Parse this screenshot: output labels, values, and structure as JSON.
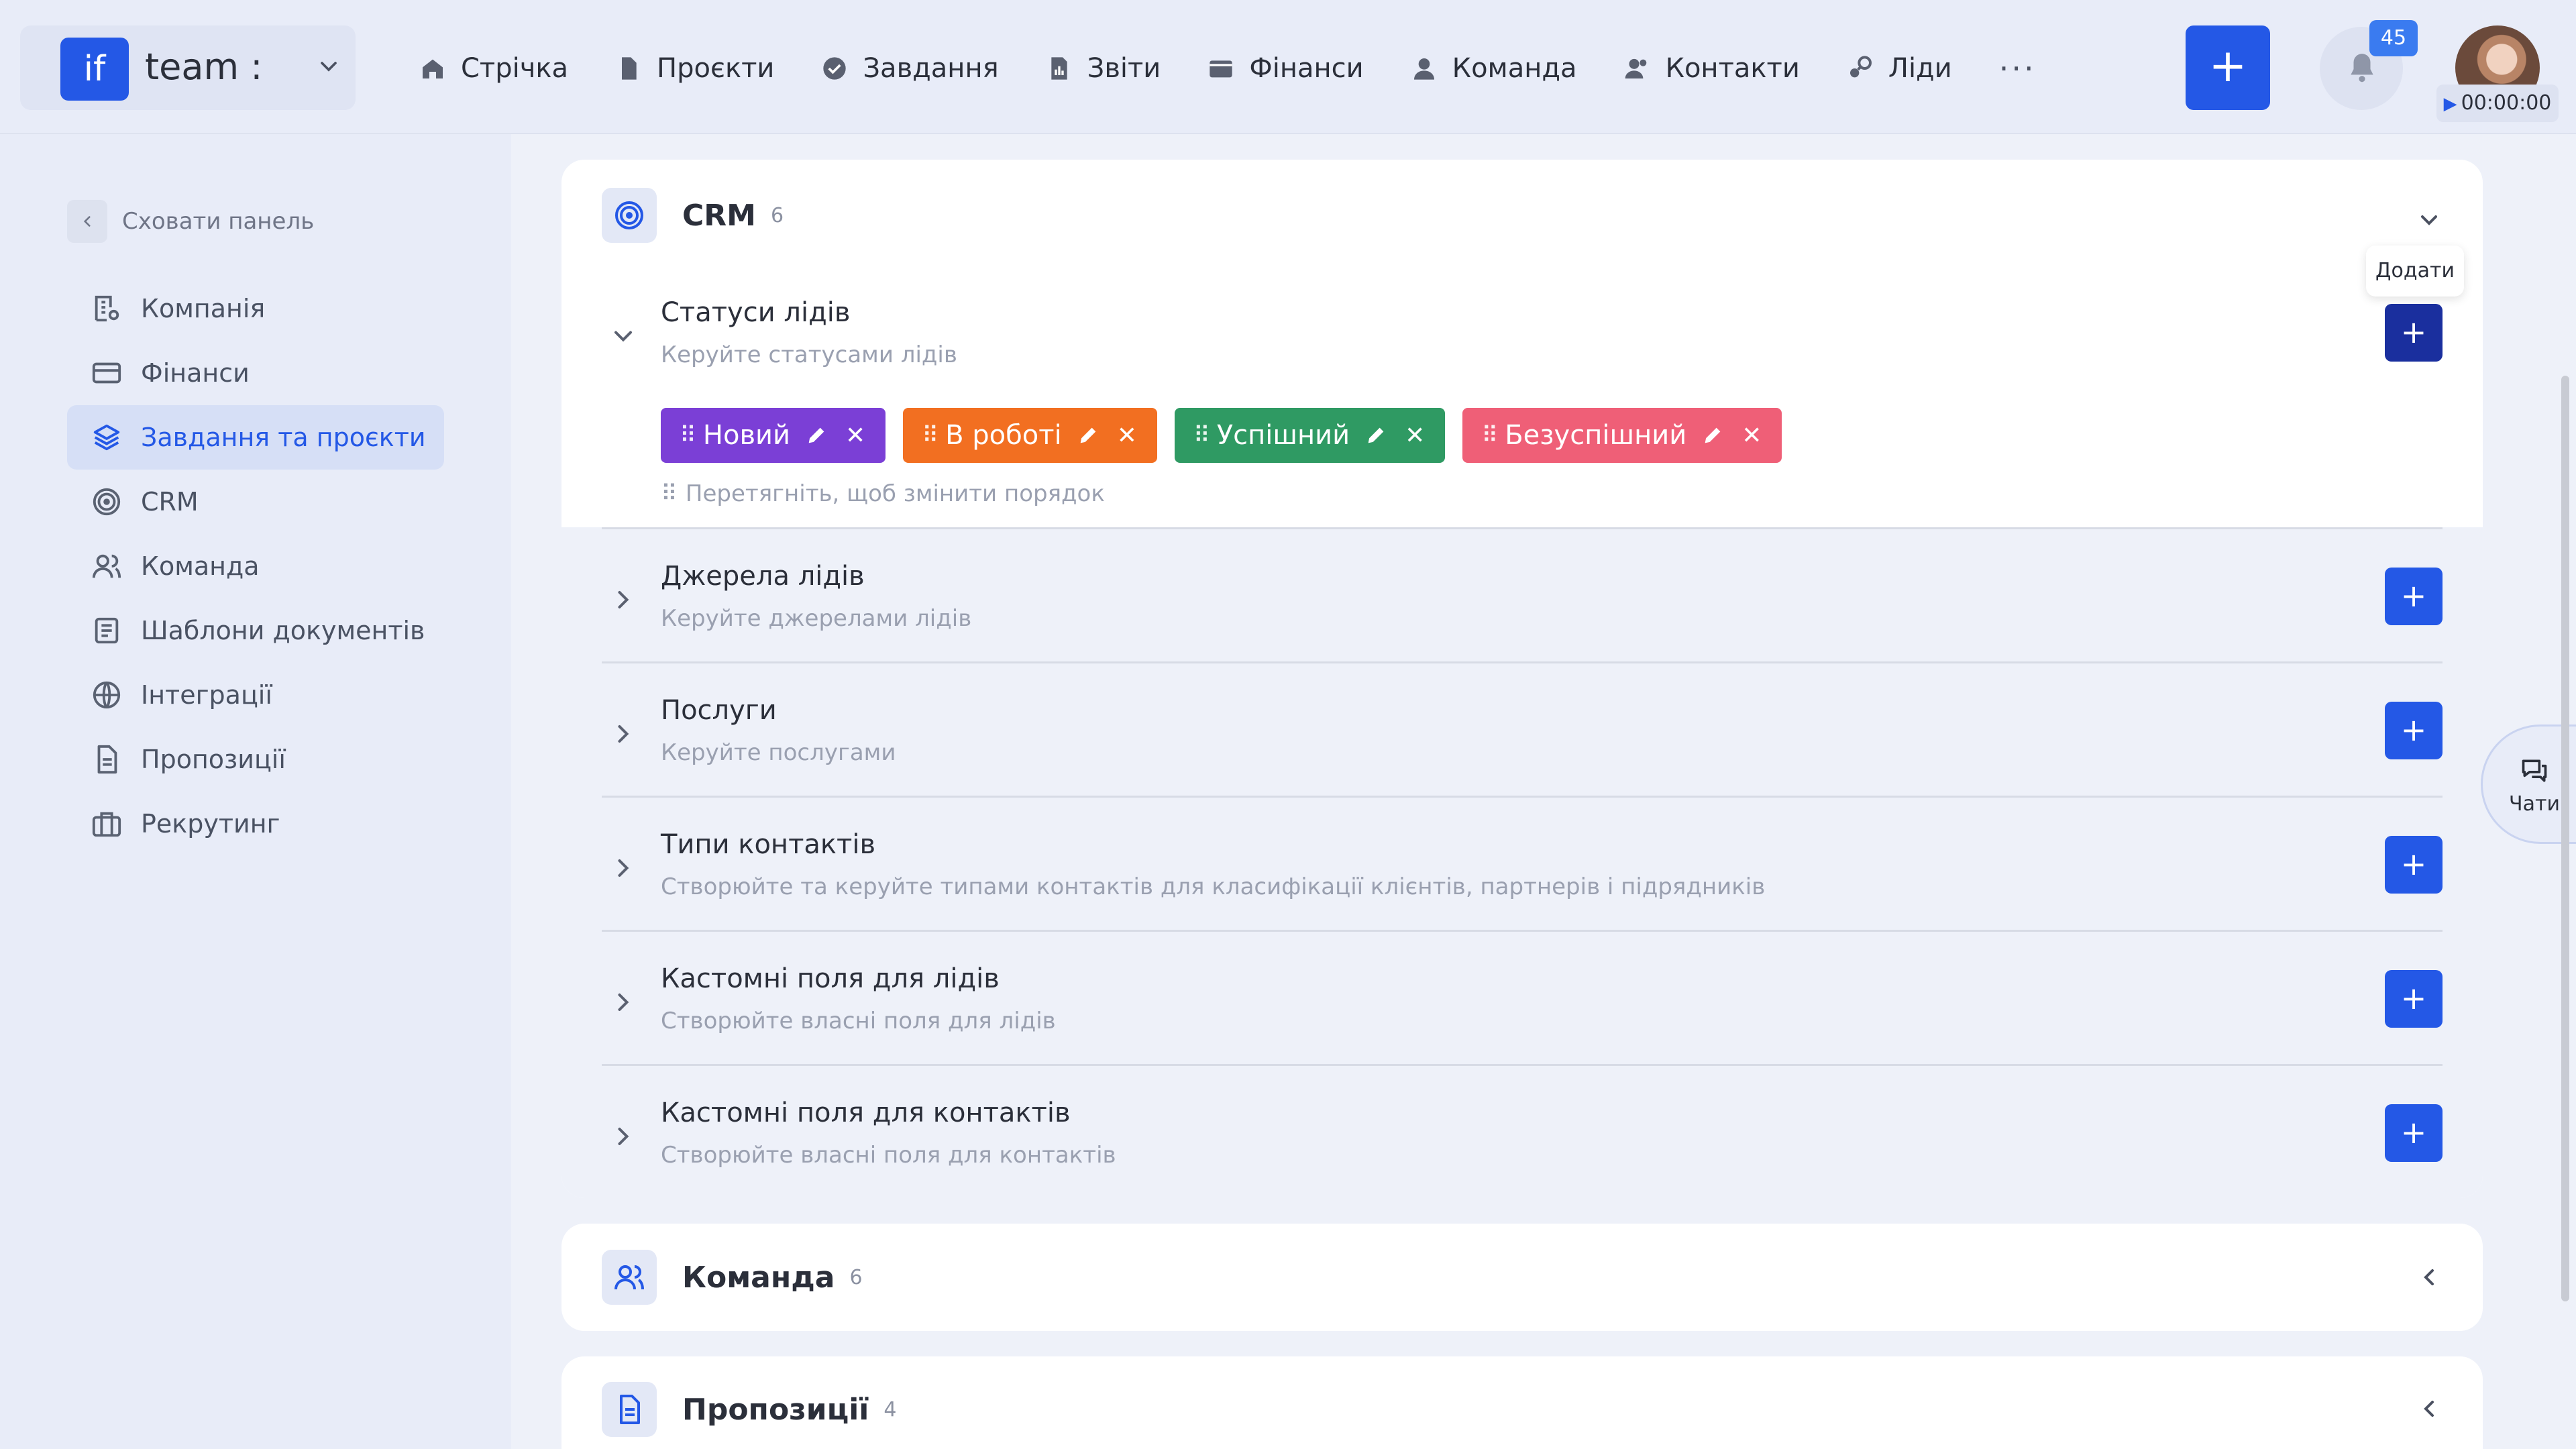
{
  "app": {
    "logo": "if",
    "team_name": "team :"
  },
  "nav": [
    {
      "label": "Стрічка",
      "icon": "home-icon"
    },
    {
      "label": "Проєкти",
      "icon": "file-icon"
    },
    {
      "label": "Завдання",
      "icon": "check-circle-icon"
    },
    {
      "label": "Звіти",
      "icon": "report-icon"
    },
    {
      "label": "Фінанси",
      "icon": "wallet-icon"
    },
    {
      "label": "Команда",
      "icon": "user-icon"
    },
    {
      "label": "Контакти",
      "icon": "contacts-icon"
    },
    {
      "label": "Ліди",
      "icon": "leads-icon"
    }
  ],
  "nav_more": "···",
  "header": {
    "add_label": "+",
    "notifications_count": "45",
    "timer": "00:00:00"
  },
  "sidebar": {
    "hide_label": "Сховати панель",
    "items": [
      {
        "label": "Компанія",
        "icon": "building-icon"
      },
      {
        "label": "Фінанси",
        "icon": "card-icon"
      },
      {
        "label": "Завдання та проєкти",
        "icon": "layers-icon",
        "active": true
      },
      {
        "label": "CRM",
        "icon": "target-icon"
      },
      {
        "label": "Команда",
        "icon": "users-icon"
      },
      {
        "label": "Шаблони документів",
        "icon": "document-template-icon"
      },
      {
        "label": "Інтеграції",
        "icon": "globe-icon"
      },
      {
        "label": "Пропозиції",
        "icon": "proposal-icon"
      },
      {
        "label": "Рекрутинг",
        "icon": "briefcase-icon"
      }
    ]
  },
  "crm": {
    "title": "CRM",
    "count": "6",
    "tooltip": "Додати",
    "lead_statuses": {
      "title": "Статуси лідів",
      "description": "Керуйте статусами лідів",
      "chips": [
        {
          "label": "Новий",
          "color": "#7b3fd6"
        },
        {
          "label": "В роботі",
          "color": "#f26f21"
        },
        {
          "label": "Успішний",
          "color": "#2f9a63"
        },
        {
          "label": "Безуспішний",
          "color": "#ef5f77"
        }
      ],
      "drag_hint": "Перетягніть, щоб змінити порядок"
    },
    "sections": [
      {
        "title": "Джерела лідів",
        "description": "Керуйте джерелами лідів"
      },
      {
        "title": "Послуги",
        "description": "Керуйте послугами"
      },
      {
        "title": "Типи контактів",
        "description": "Створюйте та керуйте типами контактів для класифікації клієнтів, партнерів і підрядників"
      },
      {
        "title": "Кастомні поля для лідів",
        "description": "Створюйте власні поля для лідів"
      },
      {
        "title": "Кастомні поля для контактів",
        "description": "Створюйте власні поля для контактів"
      }
    ]
  },
  "team_card": {
    "title": "Команда",
    "count": "6"
  },
  "proposals_card": {
    "title": "Пропозиції",
    "count": "4"
  },
  "chats": {
    "label": "Чати"
  },
  "colors": {
    "accent": "#2458e6",
    "accent_dark": "#1a2f9e",
    "background": "#eef1f9"
  }
}
